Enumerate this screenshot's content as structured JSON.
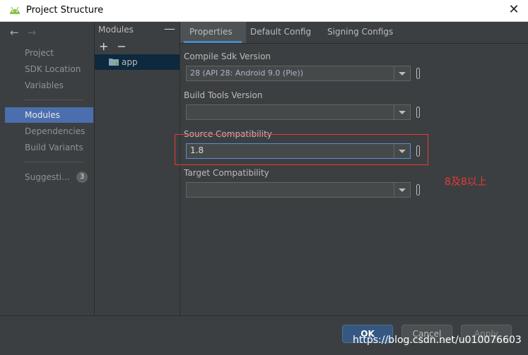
{
  "window": {
    "title": "Project Structure"
  },
  "left_nav": {
    "items": [
      {
        "label": "Project"
      },
      {
        "label": "SDK Location"
      },
      {
        "label": "Variables"
      },
      {
        "label": "Modules"
      },
      {
        "label": "Dependencies"
      },
      {
        "label": "Build Variants"
      },
      {
        "label": "Suggesti..."
      }
    ],
    "suggestions_count": "3"
  },
  "modules_panel": {
    "header": "Modules",
    "add": "+",
    "remove": "−",
    "collapse": "—",
    "items": [
      {
        "label": "app"
      }
    ]
  },
  "tabs": [
    {
      "label": "Properties"
    },
    {
      "label": "Default Config"
    },
    {
      "label": "Signing Configs"
    }
  ],
  "fields": [
    {
      "label": "Compile Sdk Version",
      "value": "28 (API 28: Android 9.0 (Pie))"
    },
    {
      "label": "Build Tools Version",
      "value": ""
    },
    {
      "label": "Source Compatibility",
      "value": "1.8"
    },
    {
      "label": "Target Compatibility",
      "value": ""
    }
  ],
  "annotation": "8及8以上",
  "buttons": {
    "ok": "OK",
    "cancel": "Cancel",
    "apply": "Apply"
  },
  "watermark": "https://blog.csdn.net/u010076603",
  "colors": {
    "accent": "#4b6eaf",
    "annotation": "#e53935",
    "background": "#3c3f41"
  }
}
